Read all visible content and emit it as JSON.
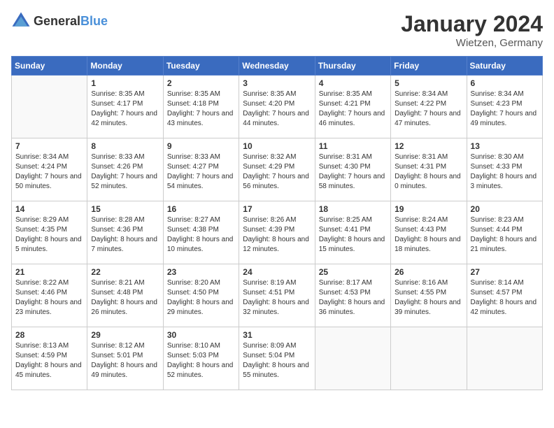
{
  "logo": {
    "general": "General",
    "blue": "Blue"
  },
  "title": {
    "month_year": "January 2024",
    "location": "Wietzen, Germany"
  },
  "days_of_week": [
    "Sunday",
    "Monday",
    "Tuesday",
    "Wednesday",
    "Thursday",
    "Friday",
    "Saturday"
  ],
  "weeks": [
    [
      {
        "day": "",
        "empty": true
      },
      {
        "day": "1",
        "sunrise": "Sunrise: 8:35 AM",
        "sunset": "Sunset: 4:17 PM",
        "daylight": "Daylight: 7 hours and 42 minutes."
      },
      {
        "day": "2",
        "sunrise": "Sunrise: 8:35 AM",
        "sunset": "Sunset: 4:18 PM",
        "daylight": "Daylight: 7 hours and 43 minutes."
      },
      {
        "day": "3",
        "sunrise": "Sunrise: 8:35 AM",
        "sunset": "Sunset: 4:20 PM",
        "daylight": "Daylight: 7 hours and 44 minutes."
      },
      {
        "day": "4",
        "sunrise": "Sunrise: 8:35 AM",
        "sunset": "Sunset: 4:21 PM",
        "daylight": "Daylight: 7 hours and 46 minutes."
      },
      {
        "day": "5",
        "sunrise": "Sunrise: 8:34 AM",
        "sunset": "Sunset: 4:22 PM",
        "daylight": "Daylight: 7 hours and 47 minutes."
      },
      {
        "day": "6",
        "sunrise": "Sunrise: 8:34 AM",
        "sunset": "Sunset: 4:23 PM",
        "daylight": "Daylight: 7 hours and 49 minutes."
      }
    ],
    [
      {
        "day": "7",
        "sunrise": "Sunrise: 8:34 AM",
        "sunset": "Sunset: 4:24 PM",
        "daylight": "Daylight: 7 hours and 50 minutes."
      },
      {
        "day": "8",
        "sunrise": "Sunrise: 8:33 AM",
        "sunset": "Sunset: 4:26 PM",
        "daylight": "Daylight: 7 hours and 52 minutes."
      },
      {
        "day": "9",
        "sunrise": "Sunrise: 8:33 AM",
        "sunset": "Sunset: 4:27 PM",
        "daylight": "Daylight: 7 hours and 54 minutes."
      },
      {
        "day": "10",
        "sunrise": "Sunrise: 8:32 AM",
        "sunset": "Sunset: 4:29 PM",
        "daylight": "Daylight: 7 hours and 56 minutes."
      },
      {
        "day": "11",
        "sunrise": "Sunrise: 8:31 AM",
        "sunset": "Sunset: 4:30 PM",
        "daylight": "Daylight: 7 hours and 58 minutes."
      },
      {
        "day": "12",
        "sunrise": "Sunrise: 8:31 AM",
        "sunset": "Sunset: 4:31 PM",
        "daylight": "Daylight: 8 hours and 0 minutes."
      },
      {
        "day": "13",
        "sunrise": "Sunrise: 8:30 AM",
        "sunset": "Sunset: 4:33 PM",
        "daylight": "Daylight: 8 hours and 3 minutes."
      }
    ],
    [
      {
        "day": "14",
        "sunrise": "Sunrise: 8:29 AM",
        "sunset": "Sunset: 4:35 PM",
        "daylight": "Daylight: 8 hours and 5 minutes."
      },
      {
        "day": "15",
        "sunrise": "Sunrise: 8:28 AM",
        "sunset": "Sunset: 4:36 PM",
        "daylight": "Daylight: 8 hours and 7 minutes."
      },
      {
        "day": "16",
        "sunrise": "Sunrise: 8:27 AM",
        "sunset": "Sunset: 4:38 PM",
        "daylight": "Daylight: 8 hours and 10 minutes."
      },
      {
        "day": "17",
        "sunrise": "Sunrise: 8:26 AM",
        "sunset": "Sunset: 4:39 PM",
        "daylight": "Daylight: 8 hours and 12 minutes."
      },
      {
        "day": "18",
        "sunrise": "Sunrise: 8:25 AM",
        "sunset": "Sunset: 4:41 PM",
        "daylight": "Daylight: 8 hours and 15 minutes."
      },
      {
        "day": "19",
        "sunrise": "Sunrise: 8:24 AM",
        "sunset": "Sunset: 4:43 PM",
        "daylight": "Daylight: 8 hours and 18 minutes."
      },
      {
        "day": "20",
        "sunrise": "Sunrise: 8:23 AM",
        "sunset": "Sunset: 4:44 PM",
        "daylight": "Daylight: 8 hours and 21 minutes."
      }
    ],
    [
      {
        "day": "21",
        "sunrise": "Sunrise: 8:22 AM",
        "sunset": "Sunset: 4:46 PM",
        "daylight": "Daylight: 8 hours and 23 minutes."
      },
      {
        "day": "22",
        "sunrise": "Sunrise: 8:21 AM",
        "sunset": "Sunset: 4:48 PM",
        "daylight": "Daylight: 8 hours and 26 minutes."
      },
      {
        "day": "23",
        "sunrise": "Sunrise: 8:20 AM",
        "sunset": "Sunset: 4:50 PM",
        "daylight": "Daylight: 8 hours and 29 minutes."
      },
      {
        "day": "24",
        "sunrise": "Sunrise: 8:19 AM",
        "sunset": "Sunset: 4:51 PM",
        "daylight": "Daylight: 8 hours and 32 minutes."
      },
      {
        "day": "25",
        "sunrise": "Sunrise: 8:17 AM",
        "sunset": "Sunset: 4:53 PM",
        "daylight": "Daylight: 8 hours and 36 minutes."
      },
      {
        "day": "26",
        "sunrise": "Sunrise: 8:16 AM",
        "sunset": "Sunset: 4:55 PM",
        "daylight": "Daylight: 8 hours and 39 minutes."
      },
      {
        "day": "27",
        "sunrise": "Sunrise: 8:14 AM",
        "sunset": "Sunset: 4:57 PM",
        "daylight": "Daylight: 8 hours and 42 minutes."
      }
    ],
    [
      {
        "day": "28",
        "sunrise": "Sunrise: 8:13 AM",
        "sunset": "Sunset: 4:59 PM",
        "daylight": "Daylight: 8 hours and 45 minutes."
      },
      {
        "day": "29",
        "sunrise": "Sunrise: 8:12 AM",
        "sunset": "Sunset: 5:01 PM",
        "daylight": "Daylight: 8 hours and 49 minutes."
      },
      {
        "day": "30",
        "sunrise": "Sunrise: 8:10 AM",
        "sunset": "Sunset: 5:03 PM",
        "daylight": "Daylight: 8 hours and 52 minutes."
      },
      {
        "day": "31",
        "sunrise": "Sunrise: 8:09 AM",
        "sunset": "Sunset: 5:04 PM",
        "daylight": "Daylight: 8 hours and 55 minutes."
      },
      {
        "day": "",
        "empty": true
      },
      {
        "day": "",
        "empty": true
      },
      {
        "day": "",
        "empty": true
      }
    ]
  ]
}
